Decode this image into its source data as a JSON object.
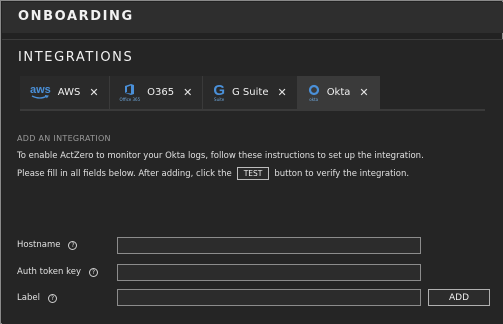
{
  "header": {
    "title": "ONBOARDING"
  },
  "integrations": {
    "title": "INTEGRATIONS",
    "tabs": [
      {
        "label": "AWS",
        "logo_text": "aws",
        "icon": "aws-logo-icon"
      },
      {
        "label": "O365",
        "logo_text": "Office 365",
        "icon": "office365-logo-icon"
      },
      {
        "label": "G Suite",
        "logo_text": "G",
        "logo_sub": "Suite",
        "icon": "gsuite-logo-icon"
      },
      {
        "label": "Okta",
        "logo_text": "okta",
        "icon": "okta-logo-icon",
        "active": true
      }
    ],
    "close_glyph": "✕"
  },
  "form": {
    "heading": "ADD AN INTEGRATION",
    "instruction_1": "To enable ActZero to monitor your Okta logs, follow these instructions to set up the integration.",
    "instruction_2_before": "Please fill in all fields below. After adding, click the",
    "test_chip": "TEST",
    "instruction_2_after": "button to verify the integration.",
    "help_glyph": "?",
    "fields": [
      {
        "label": "Hostname",
        "value": "",
        "placeholder": ""
      },
      {
        "label": "Auth token key",
        "value": "",
        "placeholder": ""
      },
      {
        "label": "Label",
        "value": "",
        "placeholder": ""
      }
    ],
    "add_label": "ADD"
  },
  "colors": {
    "background": "#222222",
    "accent": "#4a90d9",
    "text": "#e6e6e6"
  }
}
